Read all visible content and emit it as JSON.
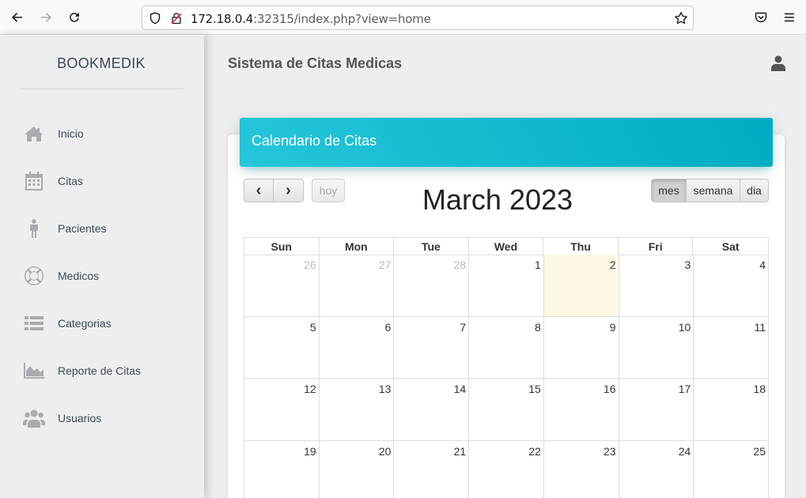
{
  "browser": {
    "url_host": "172.18.0.4",
    "url_rest": ":32315/index.php?view=home"
  },
  "sidebar": {
    "brand": "BOOKMEDIK",
    "items": [
      {
        "label": "Inicio",
        "icon": "home-icon"
      },
      {
        "label": "Citas",
        "icon": "calendar-icon"
      },
      {
        "label": "Pacientes",
        "icon": "male-icon"
      },
      {
        "label": "Medicos",
        "icon": "life-ring-icon"
      },
      {
        "label": "Categorias",
        "icon": "list-icon"
      },
      {
        "label": "Reporte de Citas",
        "icon": "area-chart-icon"
      },
      {
        "label": "Usuarios",
        "icon": "users-icon"
      }
    ]
  },
  "header": {
    "title": "Sistema de Citas Medicas",
    "user_icon": "user-icon"
  },
  "calendar": {
    "card_title": "Calendario de Citas",
    "prev_label": "‹",
    "next_label": "›",
    "today_label": "hoy",
    "title": "March 2023",
    "view_month": "mes",
    "view_week": "semana",
    "view_day": "dia",
    "active_view": "mes",
    "weekdays": [
      "Sun",
      "Mon",
      "Tue",
      "Wed",
      "Thu",
      "Fri",
      "Sat"
    ],
    "weeks": [
      [
        "26",
        "27",
        "28",
        "1",
        "2",
        "3",
        "4"
      ],
      [
        "5",
        "6",
        "7",
        "8",
        "9",
        "10",
        "11"
      ],
      [
        "12",
        "13",
        "14",
        "15",
        "16",
        "17",
        "18"
      ],
      [
        "19",
        "20",
        "21",
        "22",
        "23",
        "24",
        "25"
      ]
    ],
    "today": "2",
    "colors": {
      "header_start": "#26c6da",
      "header_end": "#00acc1",
      "today_bg": "#fcf8e3"
    }
  }
}
